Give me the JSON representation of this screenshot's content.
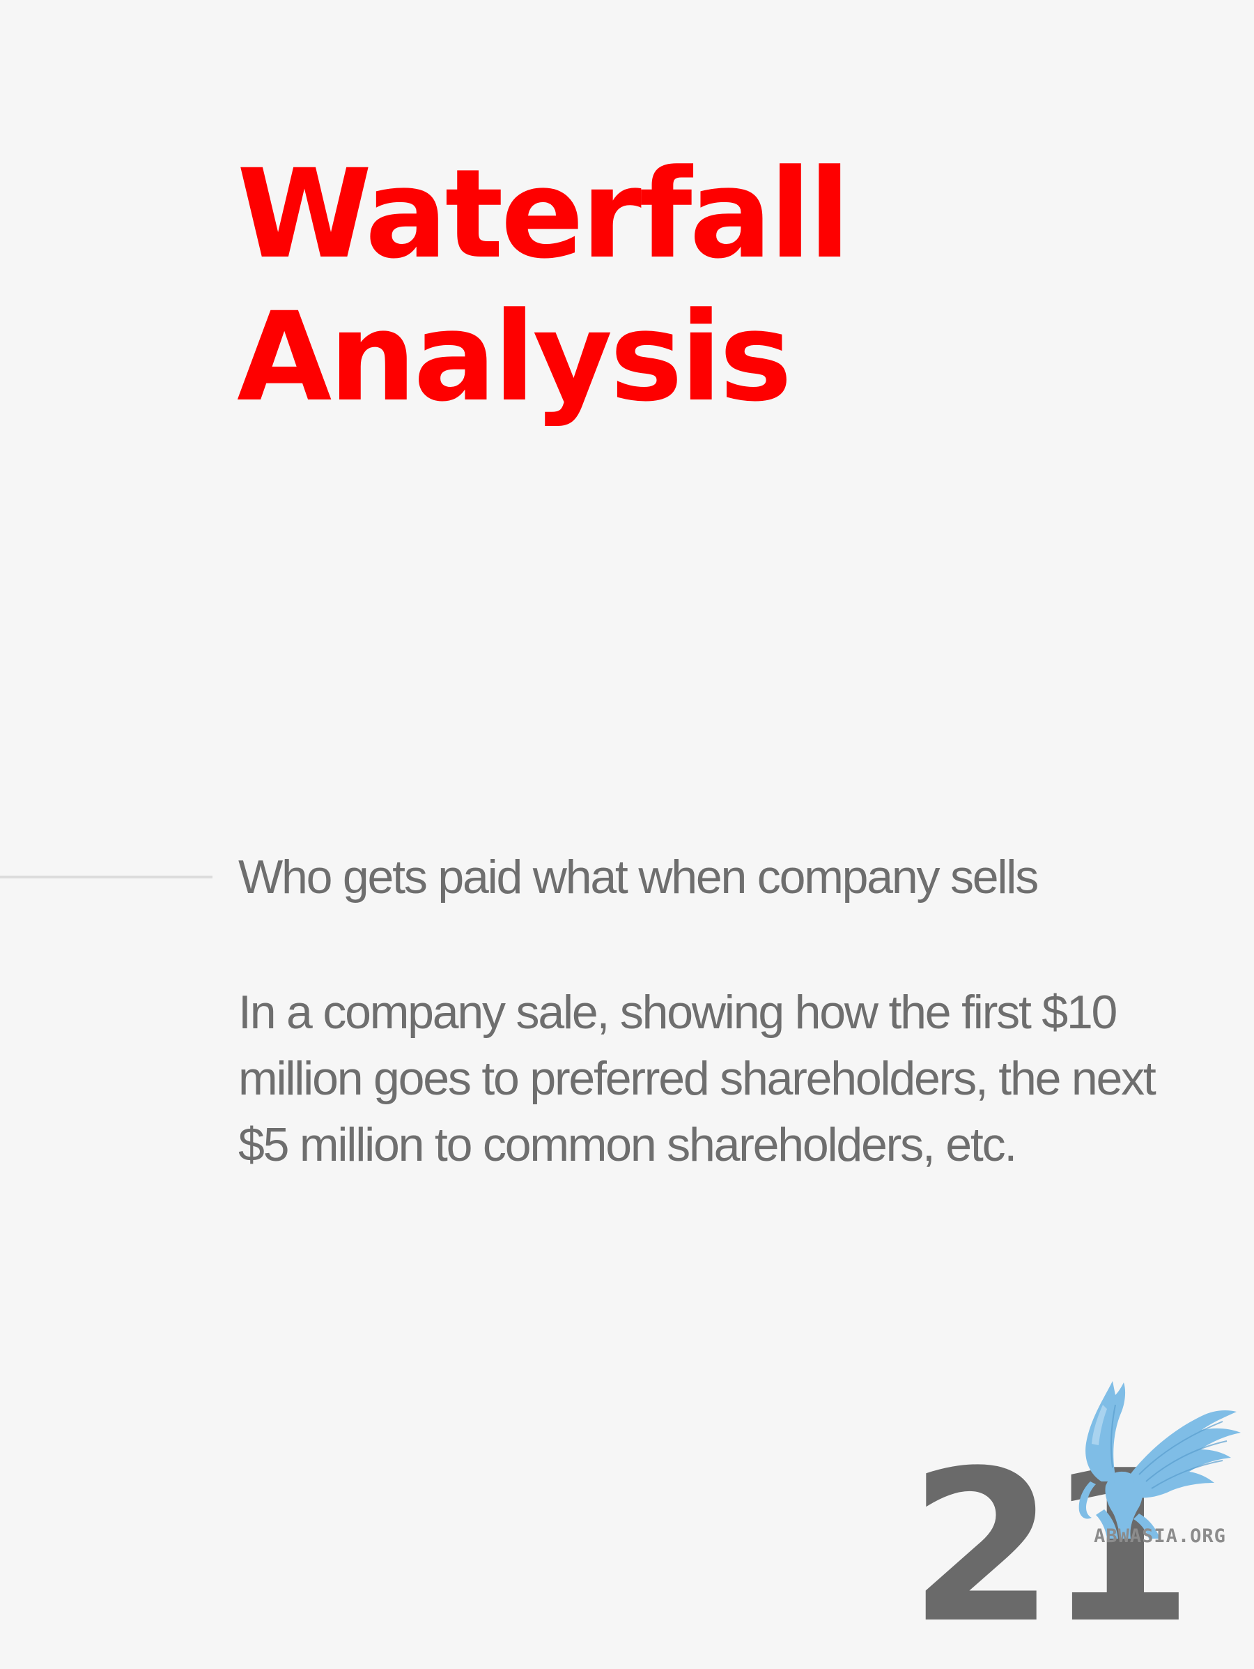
{
  "title": {
    "line1": "Waterfall",
    "line2": "Analysis"
  },
  "subtitle": "Who gets paid what when company sells",
  "body": "In a company sale, showing how the first $10 million goes to preferred shareholders, the next $5 million to common shareholders, etc.",
  "page_number": "21",
  "watermark": {
    "text": "ABWASIA.ORG",
    "icon": "winged-lion-icon"
  },
  "colors": {
    "title": "#fe0000",
    "text": "#6e6e6e",
    "background": "#f6f6f6",
    "divider": "#dcdcdc",
    "logo": "#7fbde6"
  }
}
